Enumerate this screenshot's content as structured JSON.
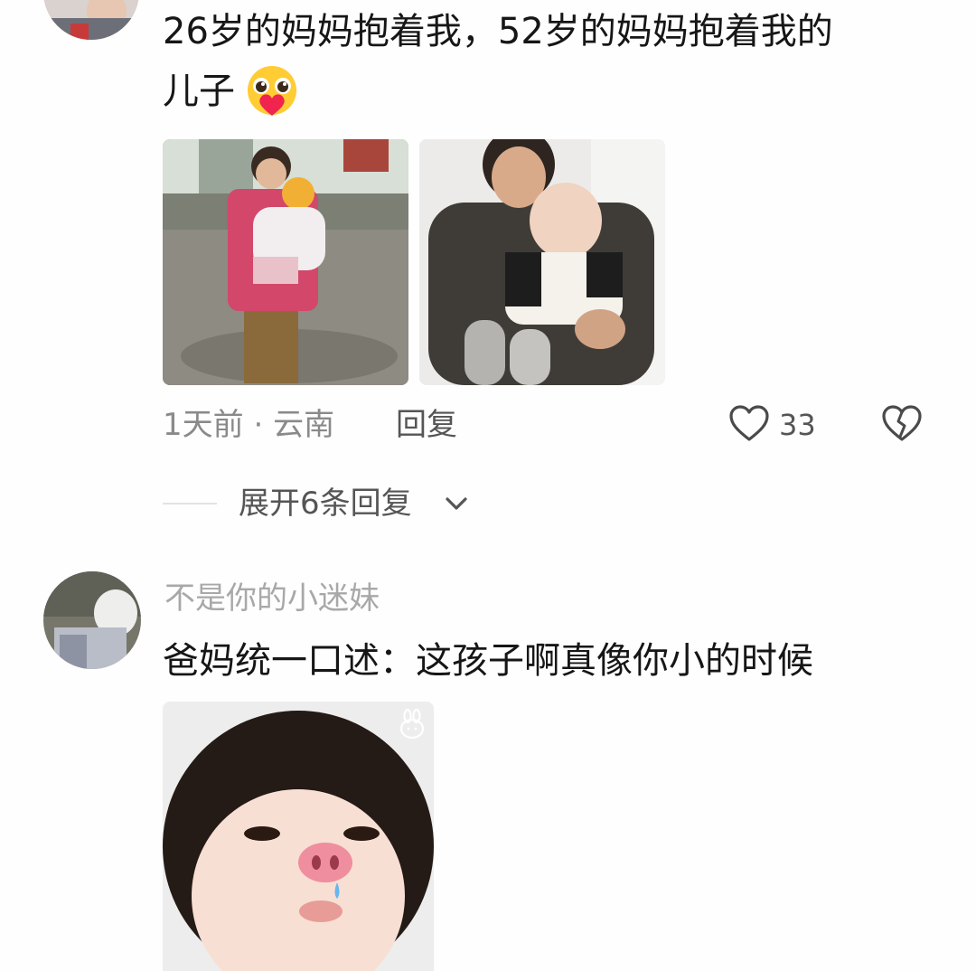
{
  "comment1": {
    "text_line1": "26岁的妈妈抱着我，52岁的妈妈抱着我的",
    "text_line2": "儿子",
    "emoji": "pleading-heart-emoji",
    "time": "1天前",
    "separator": "·",
    "location": "云南",
    "reply_label": "回复",
    "like_count": "33",
    "expand_label": "展开6条回复",
    "photos": [
      "old-photo-mother-holding-baby",
      "new-photo-grandmother-holding-baby"
    ]
  },
  "comment2": {
    "username": "不是你的小迷妹",
    "text": "爸妈统一口述：这孩子啊真像你小的时候",
    "photo": "toddler-pig-nose-sticker-photo"
  },
  "icons": {
    "like": "heart-outline-icon",
    "dislike": "broken-heart-icon",
    "chevron": "chevron-down-icon",
    "watermark": "rabbit-watermark-icon"
  },
  "colors": {
    "text": "#161616",
    "meta": "#8a8a8a",
    "username": "#a8a8a8"
  }
}
